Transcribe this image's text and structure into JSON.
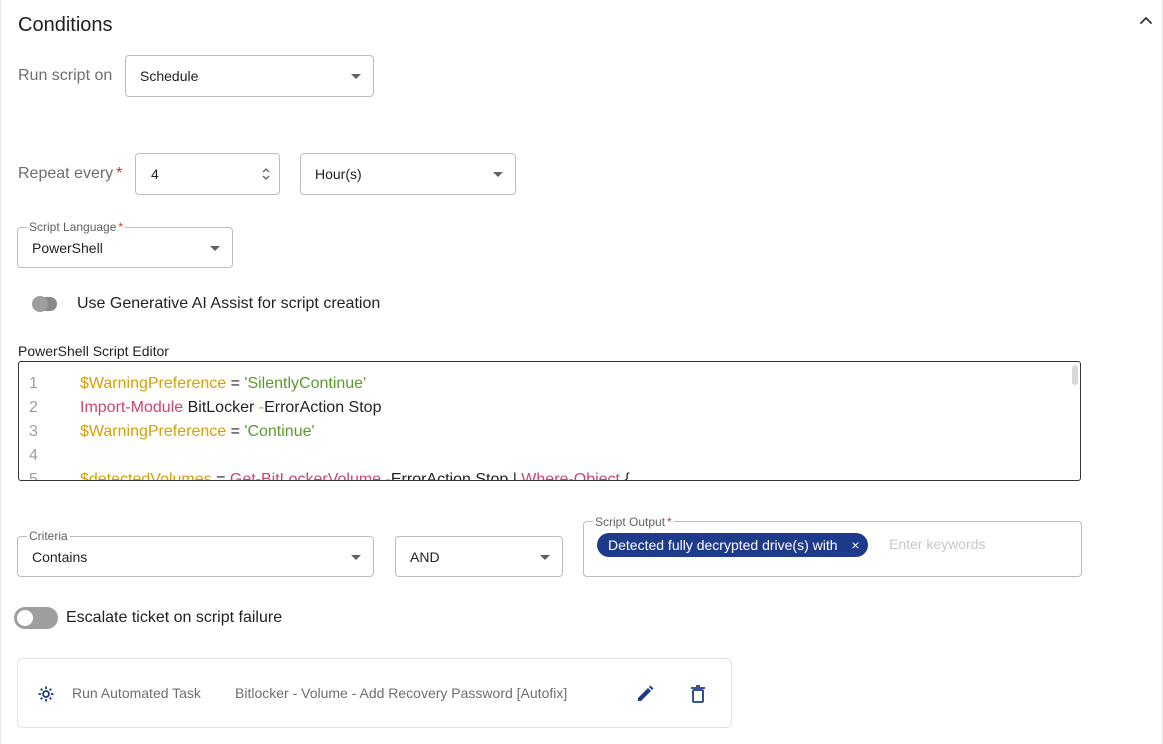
{
  "section": {
    "title": "Conditions"
  },
  "run_script": {
    "label": "Run script on",
    "value": "Schedule"
  },
  "repeat": {
    "label": "Repeat every",
    "required_mark": "*",
    "value": "4",
    "unit": "Hour(s)"
  },
  "script_language": {
    "legend": "Script Language",
    "required_mark": "*",
    "value": "PowerShell"
  },
  "ai_assist": {
    "label": "Use Generative AI Assist for script creation",
    "enabled": false
  },
  "editor": {
    "label": "PowerShell Script Editor",
    "lines": [
      {
        "n": "1",
        "tokens": [
          {
            "t": "$WarningPreference",
            "c": "var"
          },
          {
            "t": " = ",
            "c": "op"
          },
          {
            "t": "'SilentlyContinue'",
            "c": "str"
          }
        ]
      },
      {
        "n": "2",
        "tokens": [
          {
            "t": "Import-Module",
            "c": "cmd"
          },
          {
            "t": " BitLocker ",
            "c": "arg"
          },
          {
            "t": "-",
            "c": "var"
          },
          {
            "t": "ErrorAction Stop",
            "c": "arg"
          }
        ]
      },
      {
        "n": "3",
        "tokens": [
          {
            "t": "$WarningPreference",
            "c": "var"
          },
          {
            "t": " = ",
            "c": "op"
          },
          {
            "t": "'Continue'",
            "c": "str"
          }
        ]
      },
      {
        "n": "4",
        "tokens": []
      },
      {
        "n": "5",
        "tokens": [
          {
            "t": "$detectedVolumes",
            "c": "var"
          },
          {
            "t": " = ",
            "c": "op"
          },
          {
            "t": "Get-BitLockerVolume",
            "c": "cmd"
          },
          {
            "t": " -",
            "c": "var"
          },
          {
            "t": "ErrorAction Stop ",
            "c": "arg"
          },
          {
            "t": "| ",
            "c": "op"
          },
          {
            "t": "Where-Object",
            "c": "cmd"
          },
          {
            "t": " {",
            "c": "arg"
          }
        ]
      }
    ]
  },
  "criteria": {
    "legend": "Criteria",
    "value": "Contains",
    "operator": "AND"
  },
  "script_output": {
    "legend": "Script Output",
    "required_mark": "*",
    "chip": "Detected fully decrypted drive(s) with",
    "chip_remove": "×",
    "placeholder": "Enter keywords"
  },
  "escalate": {
    "label": "Escalate ticket on script failure",
    "enabled": false
  },
  "task": {
    "name": "Run Automated Task",
    "description": "Bitlocker - Volume - Add Recovery Password [Autofix]"
  },
  "colors": {
    "chip_bg": "#1e3a8a",
    "variable": "#d79f00",
    "string": "#5c9a2e",
    "command": "#d2446e",
    "icon_blue": "#1e3a8a"
  }
}
